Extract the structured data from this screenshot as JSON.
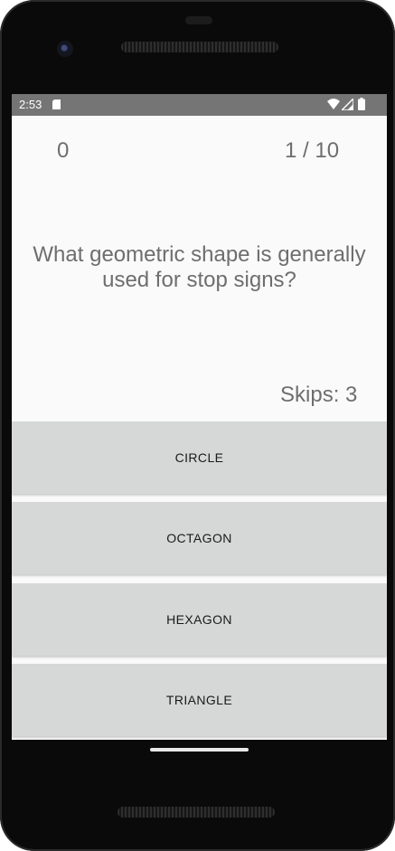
{
  "status_bar": {
    "time": "2:53",
    "sd_icon": "sd-card-icon",
    "wifi_icon": "wifi-icon",
    "signal_icon": "cell-signal-icon",
    "battery_icon": "battery-icon",
    "background": "#757575"
  },
  "quiz": {
    "score": "0",
    "progress": "1 / 10",
    "question": "What geometric shape is generally used for stop signs?",
    "skips": "Skips: 3"
  },
  "answers": [
    {
      "label": "CIRCLE"
    },
    {
      "label": "OCTAGON"
    },
    {
      "label": "HEXAGON"
    },
    {
      "label": "TRIANGLE"
    }
  ],
  "colors": {
    "screen_background": "#fafafa",
    "text_gray": "#6e6e6e",
    "button_background": "#d6d7d7",
    "device_frame": "#0a0a0a"
  }
}
